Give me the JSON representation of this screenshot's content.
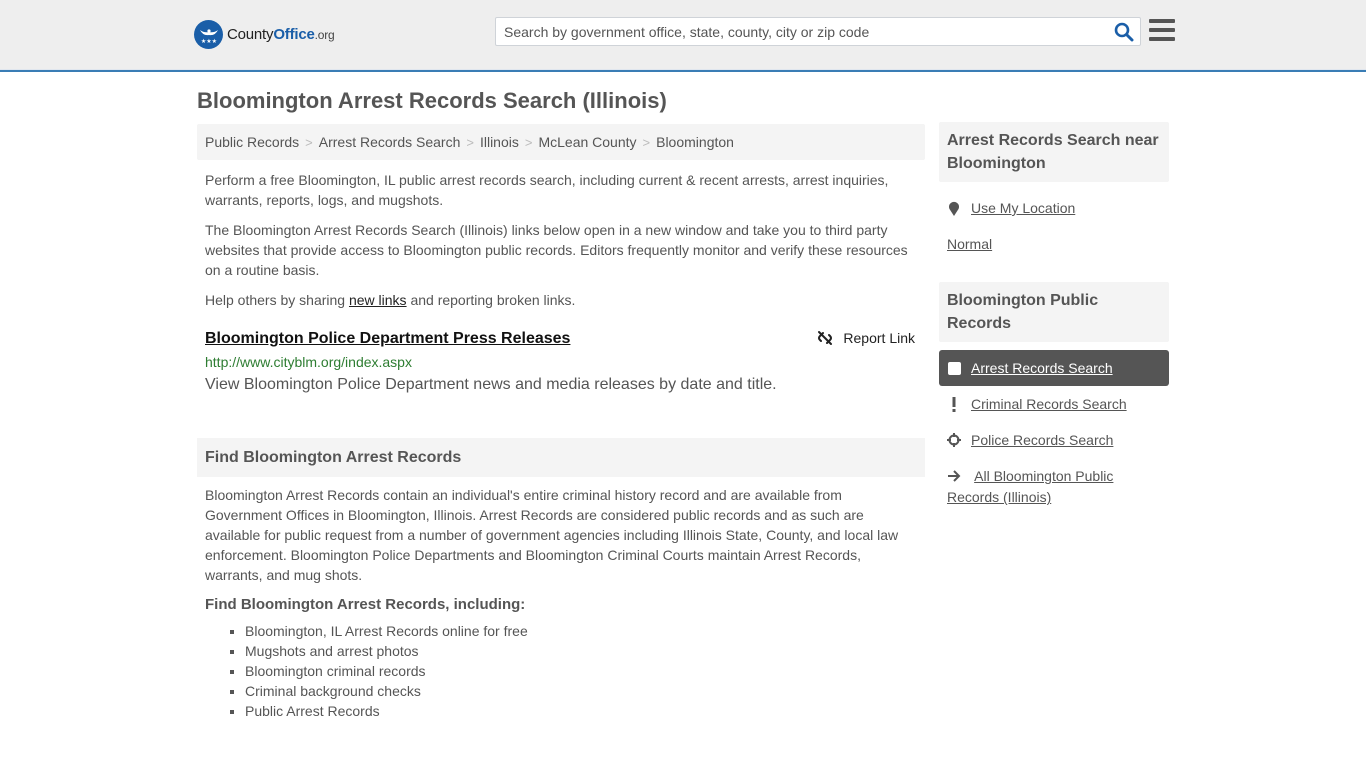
{
  "header": {
    "logo": {
      "prefix": "County",
      "brand": "Office",
      "suffix": ".org"
    },
    "search_placeholder": "Search by government office, state, county, city or zip code",
    "search_icon": "search-icon",
    "menu_icon": "hamburger-menu-icon"
  },
  "page": {
    "title": "Bloomington Arrest Records Search (Illinois)"
  },
  "breadcrumb": [
    {
      "label": "Public Records"
    },
    {
      "label": "Arrest Records Search"
    },
    {
      "label": "Illinois"
    },
    {
      "label": "McLean County"
    },
    {
      "label": "Bloomington"
    }
  ],
  "breadcrumb_separator": ">",
  "intro": {
    "p1": "Perform a free Bloomington, IL public arrest records search, including current & recent arrests, arrest inquiries, warrants, reports, logs, and mugshots.",
    "p2": "The Bloomington Arrest Records Search (Illinois) links below open in a new window and take you to third party websites that provide access to Bloomington public records. Editors frequently monitor and verify these resources on a routine basis.",
    "p3_before": "Help others by sharing ",
    "p3_link": "new links",
    "p3_after": " and reporting broken links."
  },
  "results": [
    {
      "title": "Bloomington Police Department Press Releases",
      "url": "http://www.cityblm.org/index.aspx",
      "description": "View Bloomington Police Department news and media releases by date and title.",
      "report_label": "Report Link"
    }
  ],
  "find_section": {
    "heading": "Find Bloomington Arrest Records",
    "body": "Bloomington Arrest Records contain an individual's entire criminal history record and are available from Government Offices in Bloomington, Illinois. Arrest Records are considered public records and as such are available for public request from a number of government agencies including Illinois State, County, and local law enforcement. Bloomington Police Departments and Bloomington Criminal Courts maintain Arrest Records, warrants, and mug shots.",
    "subheading": "Find Bloomington Arrest Records, including:",
    "items": [
      "Bloomington, IL Arrest Records online for free",
      "Mugshots and arrest photos",
      "Bloomington criminal records",
      "Criminal background checks",
      "Public Arrest Records"
    ]
  },
  "sidebar": {
    "near_heading": "Arrest Records Search near Bloomington",
    "use_location": "Use My Location",
    "normal": "Normal",
    "public_heading": "Bloomington Public Records",
    "links": [
      {
        "label": "Arrest Records Search",
        "icon": "square-icon",
        "active": true
      },
      {
        "label": "Criminal Records Search",
        "icon": "exclamation-icon",
        "active": false
      },
      {
        "label": "Police Records Search",
        "icon": "crosshair-icon",
        "active": false
      },
      {
        "label": "All Bloomington Public Records (Illinois)",
        "icon": "arrow-right-icon",
        "active": false
      }
    ]
  },
  "colors": {
    "brand_blue": "#1a5ea8",
    "header_border": "#3a7db5",
    "url_green": "#2e7d32",
    "active_bg": "#555555"
  }
}
